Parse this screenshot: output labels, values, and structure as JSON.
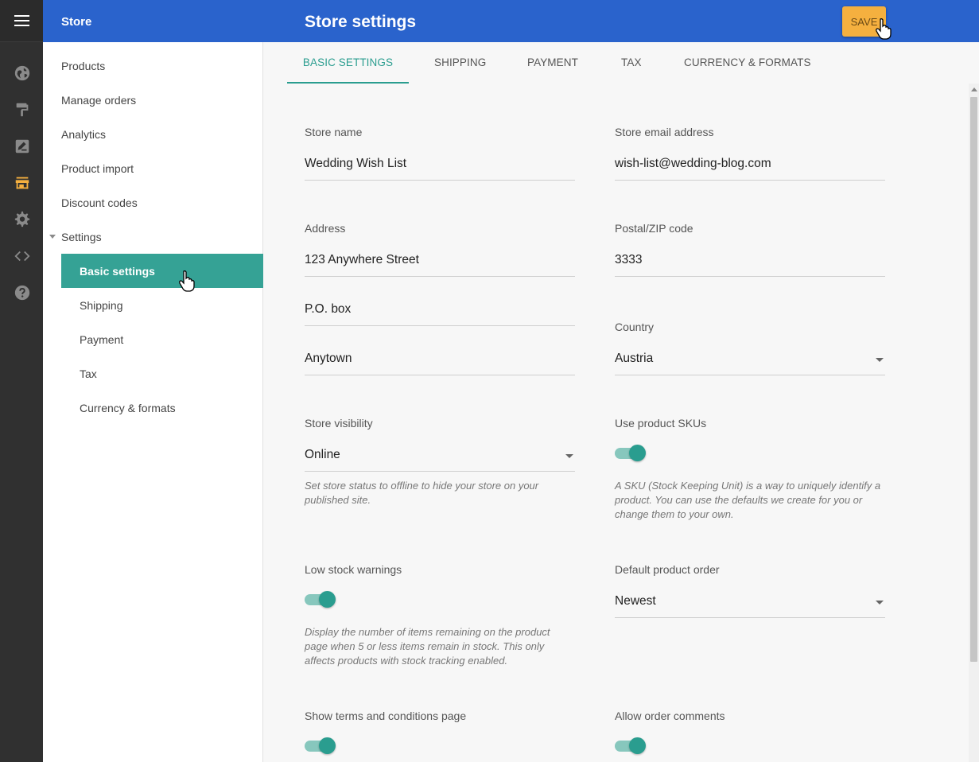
{
  "rail": {
    "icons": [
      "menu-icon",
      "globe-icon",
      "paint-roller-icon",
      "edit-icon",
      "store-icon",
      "gear-icon",
      "code-icon",
      "help-icon"
    ],
    "active_color": "#f5b03f"
  },
  "header": {
    "app_name": "Store",
    "page_title": "Store settings",
    "save_label": "SAVE"
  },
  "sidebar": {
    "items": [
      {
        "label": "Products"
      },
      {
        "label": "Manage orders"
      },
      {
        "label": "Analytics"
      },
      {
        "label": "Product import"
      },
      {
        "label": "Discount codes"
      },
      {
        "label": "Settings"
      }
    ],
    "sub_items": [
      {
        "label": "Basic settings",
        "active": true
      },
      {
        "label": "Shipping"
      },
      {
        "label": "Payment"
      },
      {
        "label": "Tax"
      },
      {
        "label": "Currency & formats"
      }
    ]
  },
  "tabs": [
    {
      "label": "BASIC SETTINGS",
      "active": true
    },
    {
      "label": "SHIPPING"
    },
    {
      "label": "PAYMENT"
    },
    {
      "label": "TAX"
    },
    {
      "label": "CURRENCY & FORMATS"
    }
  ],
  "form": {
    "store_name": {
      "label": "Store name",
      "value": "Wedding Wish List"
    },
    "store_email": {
      "label": "Store email address",
      "value": "wish-list@wedding-blog.com"
    },
    "address": {
      "label": "Address",
      "line1": "123 Anywhere Street",
      "line2": "P.O. box",
      "line3": "Anytown"
    },
    "postal": {
      "label": "Postal/ZIP code",
      "value": "3333"
    },
    "country": {
      "label": "Country",
      "value": "Austria"
    },
    "visibility": {
      "label": "Store visibility",
      "value": "Online",
      "help": "Set store status to offline to hide your store on your published site."
    },
    "skus": {
      "label": "Use product SKUs",
      "on": true,
      "help": "A SKU (Stock Keeping Unit) is a way to uniquely identify a product. You can use the defaults we create for you or change them to your own."
    },
    "low_stock": {
      "label": "Low stock warnings",
      "on": true,
      "help": "Display the number of items remaining on the product page when 5 or less items remain in stock. This only affects products with stock tracking enabled."
    },
    "default_order": {
      "label": "Default product order",
      "value": "Newest"
    },
    "terms": {
      "label": "Show terms and conditions page",
      "on": true
    },
    "comments": {
      "label": "Allow order comments",
      "on": true
    }
  }
}
